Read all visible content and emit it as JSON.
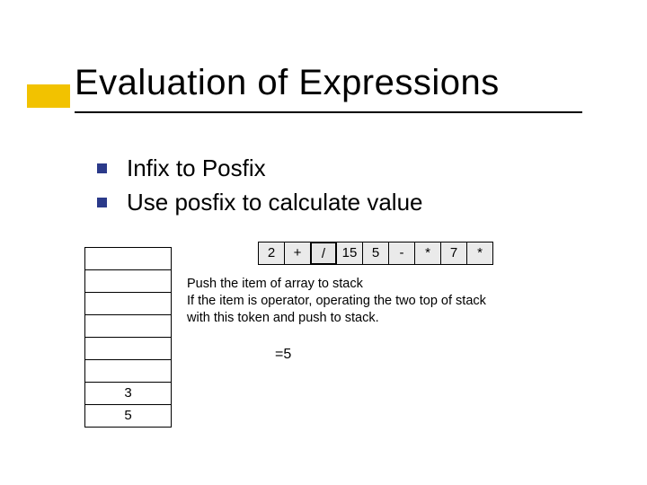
{
  "title": "Evaluation of Expressions",
  "bullets": [
    "Infix to Posfix",
    "Use  posfix to calculate value"
  ],
  "tokens": [
    "2",
    "+",
    "/",
    "15",
    "5",
    "-",
    "*",
    "7",
    "*"
  ],
  "token_strong": [
    false,
    false,
    true,
    false,
    false,
    false,
    false,
    false,
    false
  ],
  "description": [
    "Push the item of array to stack",
    "If the item is operator, operating the two top of stack",
    "with this token and push to stack."
  ],
  "equals": "=5",
  "stack": [
    "",
    "",
    "",
    "",
    "",
    "",
    "3",
    "5"
  ]
}
